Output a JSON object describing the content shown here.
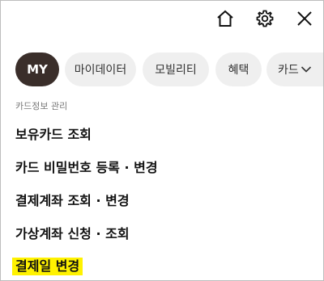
{
  "header": {
    "icons": [
      "home-icon",
      "gear-icon",
      "close-icon"
    ]
  },
  "tabs": {
    "items": [
      "MY",
      "마이데이터",
      "모빌리티",
      "혜택"
    ],
    "more_label": "카드",
    "active": "MY"
  },
  "section": {
    "title": "카드정보 관리"
  },
  "menu": {
    "items": [
      "보유카드 조회",
      "카드 비밀번호 등록 · 변경",
      "결제계좌 조회 · 변경",
      "가상계좌 신청 · 조회",
      "결제일 변경"
    ]
  },
  "colors": {
    "active_tab_bg": "#3a2e2a",
    "tab_bg": "#efefef",
    "highlight": "#fff200"
  }
}
